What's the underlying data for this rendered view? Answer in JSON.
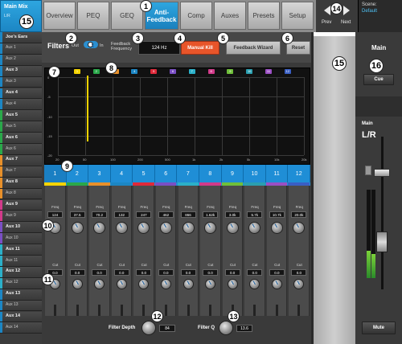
{
  "main_mix": {
    "title": "Main Mix",
    "sub": "L/R"
  },
  "sidebar_items": [
    {
      "label": "Joe's Ears",
      "sub": false,
      "color": "#1c86c4"
    },
    {
      "label": "Aux 1",
      "sub": true,
      "color": "#1c86c4"
    },
    {
      "label": "Aux 2",
      "sub": true,
      "color": "#1c86c4"
    },
    {
      "label": "Aux 3",
      "sub": false,
      "color": "#1c86c4"
    },
    {
      "label": "Aux 3",
      "sub": true,
      "color": "#1c86c4"
    },
    {
      "label": "Aux 4",
      "sub": false,
      "color": "#1c86c4"
    },
    {
      "label": "Aux 4",
      "sub": true,
      "color": "#1c86c4"
    },
    {
      "label": "Aux 5",
      "sub": false,
      "color": "#2aa84a"
    },
    {
      "label": "Aux 5",
      "sub": true,
      "color": "#2aa84a"
    },
    {
      "label": "Aux 6",
      "sub": false,
      "color": "#2aa84a"
    },
    {
      "label": "Aux 6",
      "sub": true,
      "color": "#2aa84a"
    },
    {
      "label": "Aux 7",
      "sub": false,
      "color": "#e8902a"
    },
    {
      "label": "Aux 7",
      "sub": true,
      "color": "#e8902a"
    },
    {
      "label": "Aux 8",
      "sub": false,
      "color": "#e8902a"
    },
    {
      "label": "Aux 8",
      "sub": true,
      "color": "#e8902a"
    },
    {
      "label": "Aux 9",
      "sub": false,
      "color": "#d23a8a"
    },
    {
      "label": "Aux 9",
      "sub": true,
      "color": "#d23a8a"
    },
    {
      "label": "Aux 10",
      "sub": false,
      "color": "#7a4fc4"
    },
    {
      "label": "Aux 10",
      "sub": true,
      "color": "#7a4fc4"
    },
    {
      "label": "Aux 11",
      "sub": false,
      "color": "#2bb0c9"
    },
    {
      "label": "Aux 11",
      "sub": true,
      "color": "#2bb0c9"
    },
    {
      "label": "Aux 12",
      "sub": false,
      "color": "#2bb0c9"
    },
    {
      "label": "Aux 12",
      "sub": true,
      "color": "#2bb0c9"
    },
    {
      "label": "Aux 13",
      "sub": false,
      "color": "#1c86c4"
    },
    {
      "label": "Aux 13",
      "sub": true,
      "color": "#1c86c4"
    },
    {
      "label": "Aux 14",
      "sub": false,
      "color": "#1c86c4"
    },
    {
      "label": "Aux 14",
      "sub": true,
      "color": "#1c86c4"
    }
  ],
  "tabs": [
    "Overview",
    "PEQ",
    "GEQ",
    "Anti-Feedback",
    "Comp",
    "Auxes",
    "Presets",
    "Setup"
  ],
  "nav": {
    "prev": "Prev",
    "next": "Next"
  },
  "scene": {
    "label": "Scene:",
    "value": "Default"
  },
  "filters": {
    "title": "Filters",
    "out_label": "Out",
    "in_label": "In",
    "fb_freq_label": "Feedback Frequency",
    "fb_freq_value": "124 Hz",
    "manual_kill": "Manual Kill",
    "wizard": "Feedback Wizard",
    "reset": "Reset"
  },
  "graph": {
    "y_labels": [
      "0",
      "-5",
      "-10",
      "-15",
      "-20"
    ],
    "x_labels": [
      "20",
      "50",
      "100",
      "200",
      "500",
      "1k",
      "2k",
      "5k",
      "10k",
      "20k"
    ]
  },
  "bands": [
    {
      "num": "1",
      "color": "#f5d300",
      "freq": "124",
      "cut": "0.0"
    },
    {
      "num": "2",
      "color": "#2aa84a",
      "freq": "37.5",
      "cut": "0.0"
    },
    {
      "num": "3",
      "color": "#e8902a",
      "freq": "70.2",
      "cut": "0.0"
    },
    {
      "num": "4",
      "color": "#1c86c4",
      "freq": "132",
      "cut": "0.0"
    },
    {
      "num": "5",
      "color": "#e0293a",
      "freq": "247",
      "cut": "0.0"
    },
    {
      "num": "6",
      "color": "#7a4fc4",
      "freq": "462",
      "cut": "0.0"
    },
    {
      "num": "7",
      "color": "#2bb0c9",
      "freq": "866",
      "cut": "0.0"
    },
    {
      "num": "8",
      "color": "#d23a8a",
      "freq": "1.62k",
      "cut": "0.0"
    },
    {
      "num": "9",
      "color": "#6fbf3a",
      "freq": "3.0k",
      "cut": "0.0"
    },
    {
      "num": "10",
      "color": "#2a9fb0",
      "freq": "5.7k",
      "cut": "0.0"
    },
    {
      "num": "11",
      "color": "#9b4fc4",
      "freq": "10.7k",
      "cut": "0.0"
    },
    {
      "num": "12",
      "color": "#3a5fc4",
      "freq": "20.0k",
      "cut": "0.0"
    }
  ],
  "strip_labels": {
    "freq": "Freq",
    "cut": "Cut"
  },
  "globals": {
    "depth_label": "Filter Depth",
    "depth_value": "84",
    "q_label": "Filter Q",
    "q_value": "13.6"
  },
  "right_panel": {
    "title": "Main",
    "cue": "Cue",
    "fader_label": "Main",
    "lr": "L/R",
    "mute": "Mute"
  },
  "callouts": [
    "1",
    "2",
    "3",
    "4",
    "5",
    "6",
    "7",
    "8",
    "9",
    "10",
    "11",
    "12",
    "13",
    "14",
    "15",
    "15",
    "16"
  ]
}
